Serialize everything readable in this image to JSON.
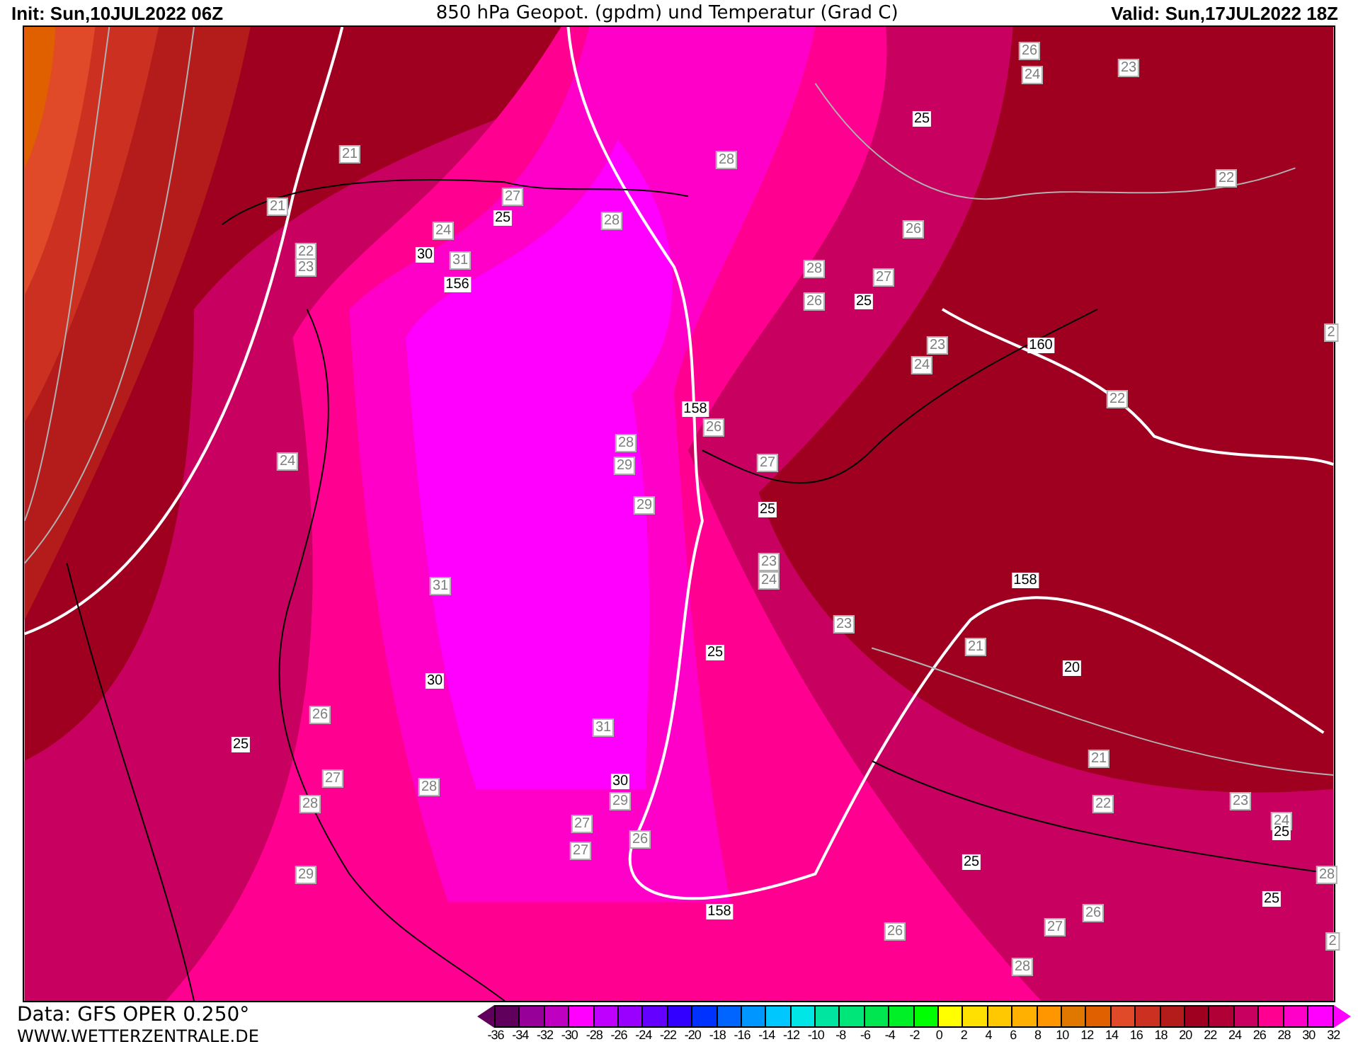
{
  "header": {
    "init": "Init: Sun,10JUL2022 06Z",
    "title": "850 hPa Geopot. (gpdm) und Temperatur (Grad C)",
    "valid": "Valid: Sun,17JUL2022 18Z"
  },
  "map": {
    "contour_labels": [
      {
        "text": "26",
        "kind": "temperature"
      },
      {
        "text": "24",
        "kind": "temperature"
      },
      {
        "text": "23",
        "kind": "temperature"
      },
      {
        "text": "25",
        "kind": "geopotential"
      },
      {
        "text": "21",
        "kind": "temperature"
      },
      {
        "text": "28",
        "kind": "temperature"
      },
      {
        "text": "22",
        "kind": "temperature"
      },
      {
        "text": "27",
        "kind": "temperature"
      },
      {
        "text": "25",
        "kind": "geopotential"
      },
      {
        "text": "21",
        "kind": "temperature"
      },
      {
        "text": "28",
        "kind": "temperature"
      },
      {
        "text": "26",
        "kind": "temperature"
      },
      {
        "text": "24",
        "kind": "temperature"
      },
      {
        "text": "22",
        "kind": "temperature"
      },
      {
        "text": "23",
        "kind": "temperature"
      },
      {
        "text": "30",
        "kind": "geopotential"
      },
      {
        "text": "31",
        "kind": "temperature"
      },
      {
        "text": "28",
        "kind": "temperature"
      },
      {
        "text": "27",
        "kind": "temperature"
      },
      {
        "text": "156",
        "kind": "geopotential"
      },
      {
        "text": "26",
        "kind": "temperature"
      },
      {
        "text": "25",
        "kind": "geopotential"
      },
      {
        "text": "23",
        "kind": "temperature"
      },
      {
        "text": "160",
        "kind": "geopotential"
      },
      {
        "text": "2",
        "kind": "temperature"
      },
      {
        "text": "24",
        "kind": "temperature"
      },
      {
        "text": "22",
        "kind": "temperature"
      },
      {
        "text": "158",
        "kind": "geopotential"
      },
      {
        "text": "26",
        "kind": "temperature"
      },
      {
        "text": "28",
        "kind": "temperature"
      },
      {
        "text": "24",
        "kind": "temperature"
      },
      {
        "text": "29",
        "kind": "temperature"
      },
      {
        "text": "27",
        "kind": "temperature"
      },
      {
        "text": "29",
        "kind": "temperature"
      },
      {
        "text": "25",
        "kind": "geopotential"
      },
      {
        "text": "23",
        "kind": "temperature"
      },
      {
        "text": "24",
        "kind": "temperature"
      },
      {
        "text": "158",
        "kind": "geopotential"
      },
      {
        "text": "31",
        "kind": "temperature"
      },
      {
        "text": "23",
        "kind": "temperature"
      },
      {
        "text": "21",
        "kind": "temperature"
      },
      {
        "text": "25",
        "kind": "geopotential"
      },
      {
        "text": "20",
        "kind": "geopotential"
      },
      {
        "text": "30",
        "kind": "geopotential"
      },
      {
        "text": "26",
        "kind": "temperature"
      },
      {
        "text": "31",
        "kind": "temperature"
      },
      {
        "text": "25",
        "kind": "geopotential"
      },
      {
        "text": "21",
        "kind": "temperature"
      },
      {
        "text": "27",
        "kind": "temperature"
      },
      {
        "text": "30",
        "kind": "geopotential"
      },
      {
        "text": "28",
        "kind": "temperature"
      },
      {
        "text": "28",
        "kind": "temperature"
      },
      {
        "text": "29",
        "kind": "temperature"
      },
      {
        "text": "22",
        "kind": "temperature"
      },
      {
        "text": "23",
        "kind": "temperature"
      },
      {
        "text": "24",
        "kind": "temperature"
      },
      {
        "text": "25",
        "kind": "geopotential"
      },
      {
        "text": "27",
        "kind": "temperature"
      },
      {
        "text": "26",
        "kind": "temperature"
      },
      {
        "text": "27",
        "kind": "temperature"
      },
      {
        "text": "25",
        "kind": "geopotential"
      },
      {
        "text": "28",
        "kind": "temperature"
      },
      {
        "text": "29",
        "kind": "temperature"
      },
      {
        "text": "158",
        "kind": "geopotential"
      },
      {
        "text": "25",
        "kind": "geopotential"
      },
      {
        "text": "27",
        "kind": "temperature"
      },
      {
        "text": "26",
        "kind": "temperature"
      },
      {
        "text": "26",
        "kind": "temperature"
      },
      {
        "text": "28",
        "kind": "temperature"
      },
      {
        "text": "2",
        "kind": "temperature"
      }
    ]
  },
  "footer": {
    "data_source": "Data: GFS OPER 0.250°",
    "website": "WWW.WETTERZENTRALE.DE"
  },
  "legend": {
    "swatches": [
      {
        "color": "#60005c"
      },
      {
        "color": "#98009a"
      },
      {
        "color": "#c000c0"
      },
      {
        "color": "#ff00ff"
      },
      {
        "color": "#c000ff"
      },
      {
        "color": "#9a00ff"
      },
      {
        "color": "#6400ff"
      },
      {
        "color": "#3200ff"
      },
      {
        "color": "#0032ff"
      },
      {
        "color": "#0064ff"
      },
      {
        "color": "#0096ff"
      },
      {
        "color": "#00c8ff"
      },
      {
        "color": "#00e6e6"
      },
      {
        "color": "#00e6a0"
      },
      {
        "color": "#00e678"
      },
      {
        "color": "#00e650"
      },
      {
        "color": "#00f028"
      },
      {
        "color": "#00ff00"
      },
      {
        "color": "#ffff00"
      },
      {
        "color": "#ffe000"
      },
      {
        "color": "#ffc800"
      },
      {
        "color": "#ffb000"
      },
      {
        "color": "#ff9600"
      },
      {
        "color": "#e07800"
      },
      {
        "color": "#e06000"
      },
      {
        "color": "#e04a28"
      },
      {
        "color": "#cc3020"
      },
      {
        "color": "#b41c1c"
      },
      {
        "color": "#a00020"
      },
      {
        "color": "#b00035"
      },
      {
        "color": "#c80060"
      },
      {
        "color": "#ff0090"
      },
      {
        "color": "#ff00c8"
      },
      {
        "color": "#ff00ff"
      }
    ],
    "labels": [
      "-36",
      "-34",
      "-32",
      "-30",
      "-28",
      "-26",
      "-24",
      "-22",
      "-20",
      "-18",
      "-16",
      "-14",
      "-12",
      "-10",
      "-8",
      "-6",
      "-4",
      "-2",
      "0",
      "2",
      "4",
      "6",
      "8",
      "10",
      "12",
      "14",
      "16",
      "18",
      "20",
      "22",
      "24",
      "26",
      "28",
      "30",
      "32"
    ]
  }
}
